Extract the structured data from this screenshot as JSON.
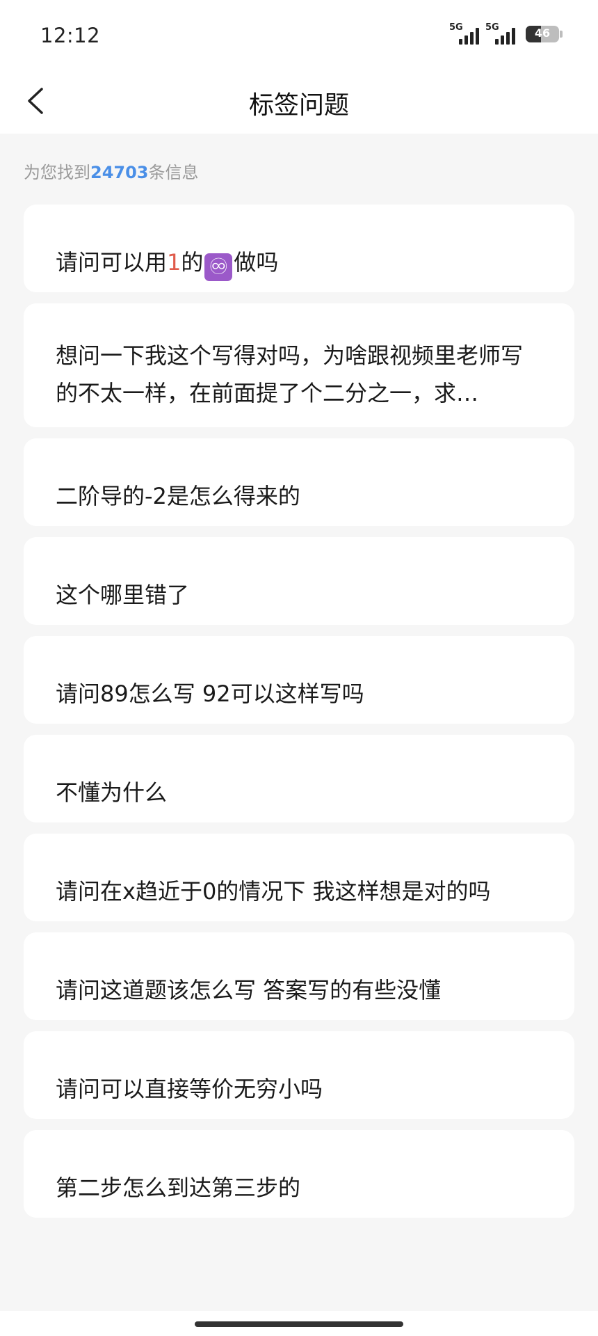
{
  "status_bar": {
    "time": "12:12",
    "signal1_label": "5G",
    "signal2_label": "5G",
    "battery": "46"
  },
  "nav": {
    "title": "标签问题",
    "back_icon": "chevron-left-icon"
  },
  "results": {
    "prefix": "为您找到",
    "count": "24703",
    "suffix": "条信息"
  },
  "colors": {
    "accent_blue": "#4a8fe7",
    "highlight_red": "#e05b4b",
    "infinity_badge": "#9b59c9"
  },
  "questions": [
    {
      "parts": [
        "请问可以用",
        "1",
        "的",
        "♾",
        "做吗"
      ]
    },
    {
      "text": "想问一下我这个写得对吗，为啥跟视频里老师写的不太一样，在前面提了个二分之一，求…"
    },
    {
      "text": "二阶导的-2是怎么得来的"
    },
    {
      "text": "这个哪里错了"
    },
    {
      "text": "请问89怎么写 92可以这样写吗"
    },
    {
      "text": "不懂为什么"
    },
    {
      "text": "请问在x趋近于0的情况下 我这样想是对的吗"
    },
    {
      "text": "请问这道题该怎么写 答案写的有些没懂"
    },
    {
      "text": "请问可以直接等价无穷小吗"
    },
    {
      "text": "第二步怎么到达第三步的"
    }
  ]
}
